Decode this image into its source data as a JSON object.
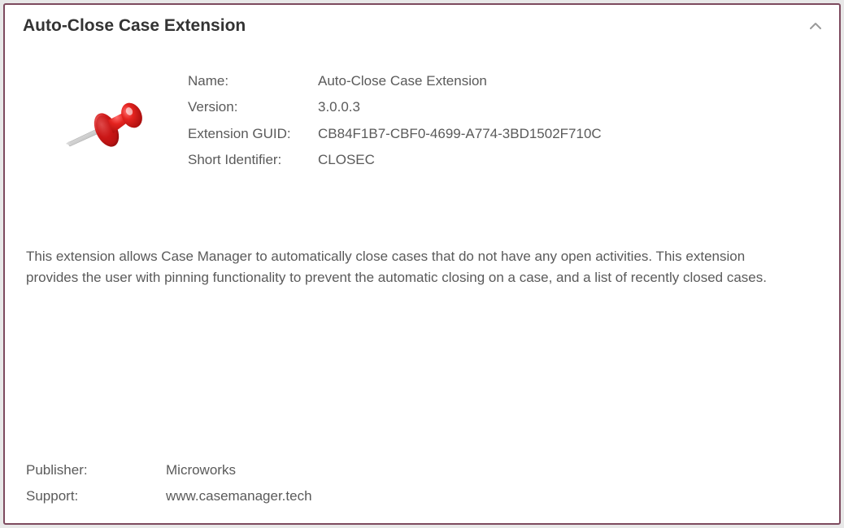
{
  "panel": {
    "title": "Auto-Close Case Extension"
  },
  "fields": {
    "name_label": "Name:",
    "name_value": "Auto-Close Case Extension",
    "version_label": "Version:",
    "version_value": "3.0.0.3",
    "guid_label": "Extension GUID:",
    "guid_value": "CB84F1B7-CBF0-4699-A774-3BD1502F710C",
    "shortid_label": "Short Identifier:",
    "shortid_value": "CLOSEC"
  },
  "description": "This extension allows Case Manager to automatically close cases that do not have any open activities. This extension provides the user with pinning functionality to prevent the automatic closing on a case, and a list of recently closed cases.",
  "footer": {
    "publisher_label": "Publisher:",
    "publisher_value": "Microworks",
    "support_label": "Support:",
    "support_value": "www.casemanager.tech"
  }
}
